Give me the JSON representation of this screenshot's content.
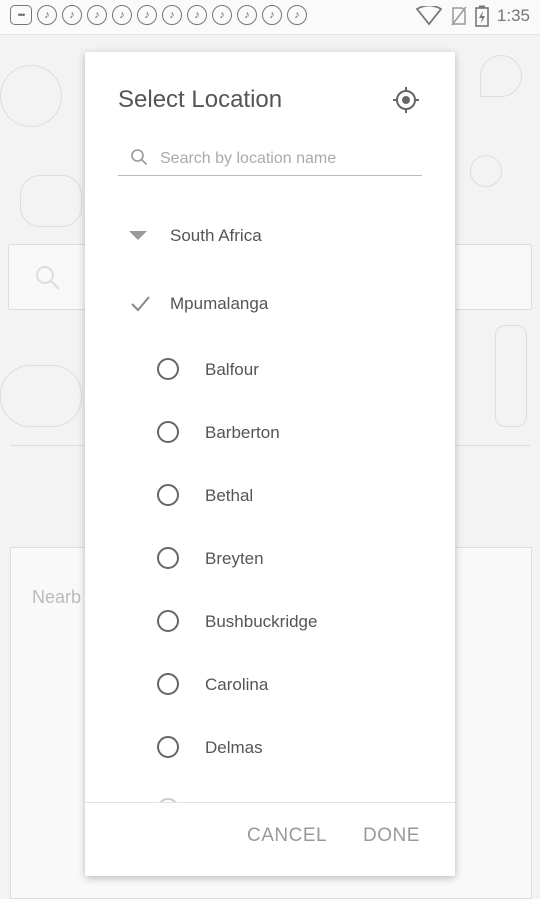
{
  "statusbar": {
    "time": "1:35",
    "notification_icons": [
      "more-icon",
      "music-note-icon",
      "music-note-icon",
      "music-note-icon",
      "music-note-icon",
      "music-note-icon",
      "music-note-icon",
      "music-note-icon",
      "music-note-icon",
      "music-note-icon",
      "music-note-icon",
      "music-note-icon"
    ]
  },
  "background": {
    "nearby_text": "Nearb"
  },
  "dialog": {
    "title": "Select Location",
    "search": {
      "placeholder": "Search by location name",
      "value": ""
    },
    "country": "South Africa",
    "province": "Mpumalanga",
    "towns": [
      "Balfour",
      "Barberton",
      "Bethal",
      "Breyten",
      "Bushbuckridge",
      "Carolina",
      "Delmas"
    ],
    "cancel_label": "CANCEL",
    "done_label": "DONE"
  },
  "colors": {
    "dialog_background": "#ffffff",
    "text": "#555555",
    "button_text": "#999999"
  }
}
